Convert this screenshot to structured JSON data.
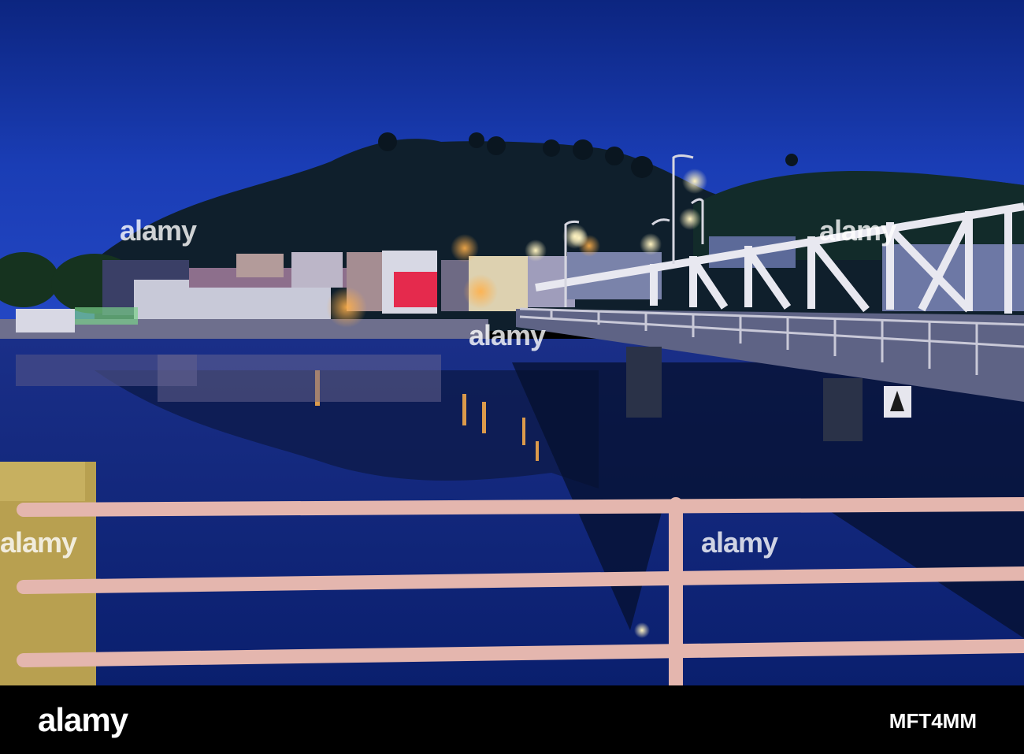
{
  "watermark": {
    "text": "alamy"
  },
  "footer": {
    "logo": "alamy",
    "image_id": "MFT4MM"
  },
  "colors": {
    "sky_top": "#0d2a8a",
    "sky_mid": "#1b3fb8",
    "hill": "#0e1e2e",
    "water": "#0a1f6e",
    "railing": "#d9a6a0",
    "street_light": "#ffd98a"
  }
}
